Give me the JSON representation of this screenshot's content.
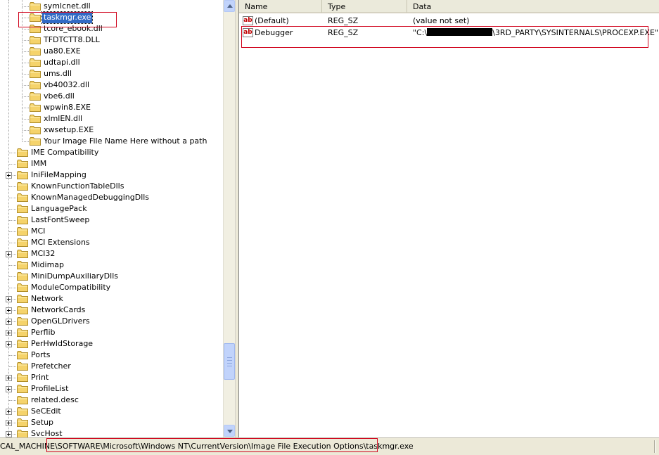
{
  "tree": {
    "items": [
      {
        "label": "symlcnet.dll",
        "expandable": false,
        "level": 2
      },
      {
        "label": "taskmgr.exe",
        "expandable": false,
        "level": 2,
        "selected": true
      },
      {
        "label": "tcore_ebook.dll",
        "expandable": false,
        "level": 2
      },
      {
        "label": "TFDTCTT8.DLL",
        "expandable": false,
        "level": 2
      },
      {
        "label": "ua80.EXE",
        "expandable": false,
        "level": 2
      },
      {
        "label": "udtapi.dll",
        "expandable": false,
        "level": 2
      },
      {
        "label": "ums.dll",
        "expandable": false,
        "level": 2
      },
      {
        "label": "vb40032.dll",
        "expandable": false,
        "level": 2
      },
      {
        "label": "vbe6.dll",
        "expandable": false,
        "level": 2
      },
      {
        "label": "wpwin8.EXE",
        "expandable": false,
        "level": 2
      },
      {
        "label": "xlmlEN.dll",
        "expandable": false,
        "level": 2
      },
      {
        "label": "xwsetup.EXE",
        "expandable": false,
        "level": 2
      },
      {
        "label": "Your Image File Name Here without a path",
        "expandable": false,
        "level": 2
      },
      {
        "label": "IME Compatibility",
        "expandable": false,
        "level": 1
      },
      {
        "label": "IMM",
        "expandable": false,
        "level": 1
      },
      {
        "label": "IniFileMapping",
        "expandable": true,
        "level": 1
      },
      {
        "label": "KnownFunctionTableDlls",
        "expandable": false,
        "level": 1
      },
      {
        "label": "KnownManagedDebuggingDlls",
        "expandable": false,
        "level": 1
      },
      {
        "label": "LanguagePack",
        "expandable": false,
        "level": 1
      },
      {
        "label": "LastFontSweep",
        "expandable": false,
        "level": 1
      },
      {
        "label": "MCI",
        "expandable": false,
        "level": 1
      },
      {
        "label": "MCI Extensions",
        "expandable": false,
        "level": 1
      },
      {
        "label": "MCI32",
        "expandable": true,
        "level": 1
      },
      {
        "label": "Midimap",
        "expandable": false,
        "level": 1
      },
      {
        "label": "MiniDumpAuxiliaryDlls",
        "expandable": false,
        "level": 1
      },
      {
        "label": "ModuleCompatibility",
        "expandable": false,
        "level": 1
      },
      {
        "label": "Network",
        "expandable": true,
        "level": 1
      },
      {
        "label": "NetworkCards",
        "expandable": true,
        "level": 1
      },
      {
        "label": "OpenGLDrivers",
        "expandable": true,
        "level": 1
      },
      {
        "label": "Perflib",
        "expandable": true,
        "level": 1
      },
      {
        "label": "PerHwIdStorage",
        "expandable": true,
        "level": 1
      },
      {
        "label": "Ports",
        "expandable": false,
        "level": 1
      },
      {
        "label": "Prefetcher",
        "expandable": false,
        "level": 1
      },
      {
        "label": "Print",
        "expandable": true,
        "level": 1
      },
      {
        "label": "ProfileList",
        "expandable": true,
        "level": 1
      },
      {
        "label": "related.desc",
        "expandable": false,
        "level": 1
      },
      {
        "label": "SeCEdit",
        "expandable": true,
        "level": 1
      },
      {
        "label": "Setup",
        "expandable": true,
        "level": 1
      },
      {
        "label": "SvcHost",
        "expandable": true,
        "level": 1
      }
    ]
  },
  "values": {
    "columns": [
      "Name",
      "Type",
      "Data"
    ],
    "rows": [
      {
        "name": "(Default)",
        "type": "REG_SZ",
        "data_before": "(value not set)",
        "data_after": "",
        "redacted": false,
        "icon": "ab-string-icon"
      },
      {
        "name": "Debugger",
        "type": "REG_SZ",
        "data_before": "\"C:\\",
        "data_after": "\\3RD_PARTY\\SYSINTERNALS\\PROCEXP.EXE\"",
        "redacted": true,
        "icon": "ab-string-icon"
      }
    ]
  },
  "statusbar": {
    "path": "CAL_MACHINE\\SOFTWARE\\Microsoft\\Windows NT\\CurrentVersion\\Image File Execution Options\\taskmgr.exe"
  },
  "colors": {
    "selection": "#316ac5",
    "annotation_red": "#d0021b",
    "folder_yellow": "#f5d36b"
  },
  "tree_scroll": {
    "position_fraction": 0.88
  }
}
